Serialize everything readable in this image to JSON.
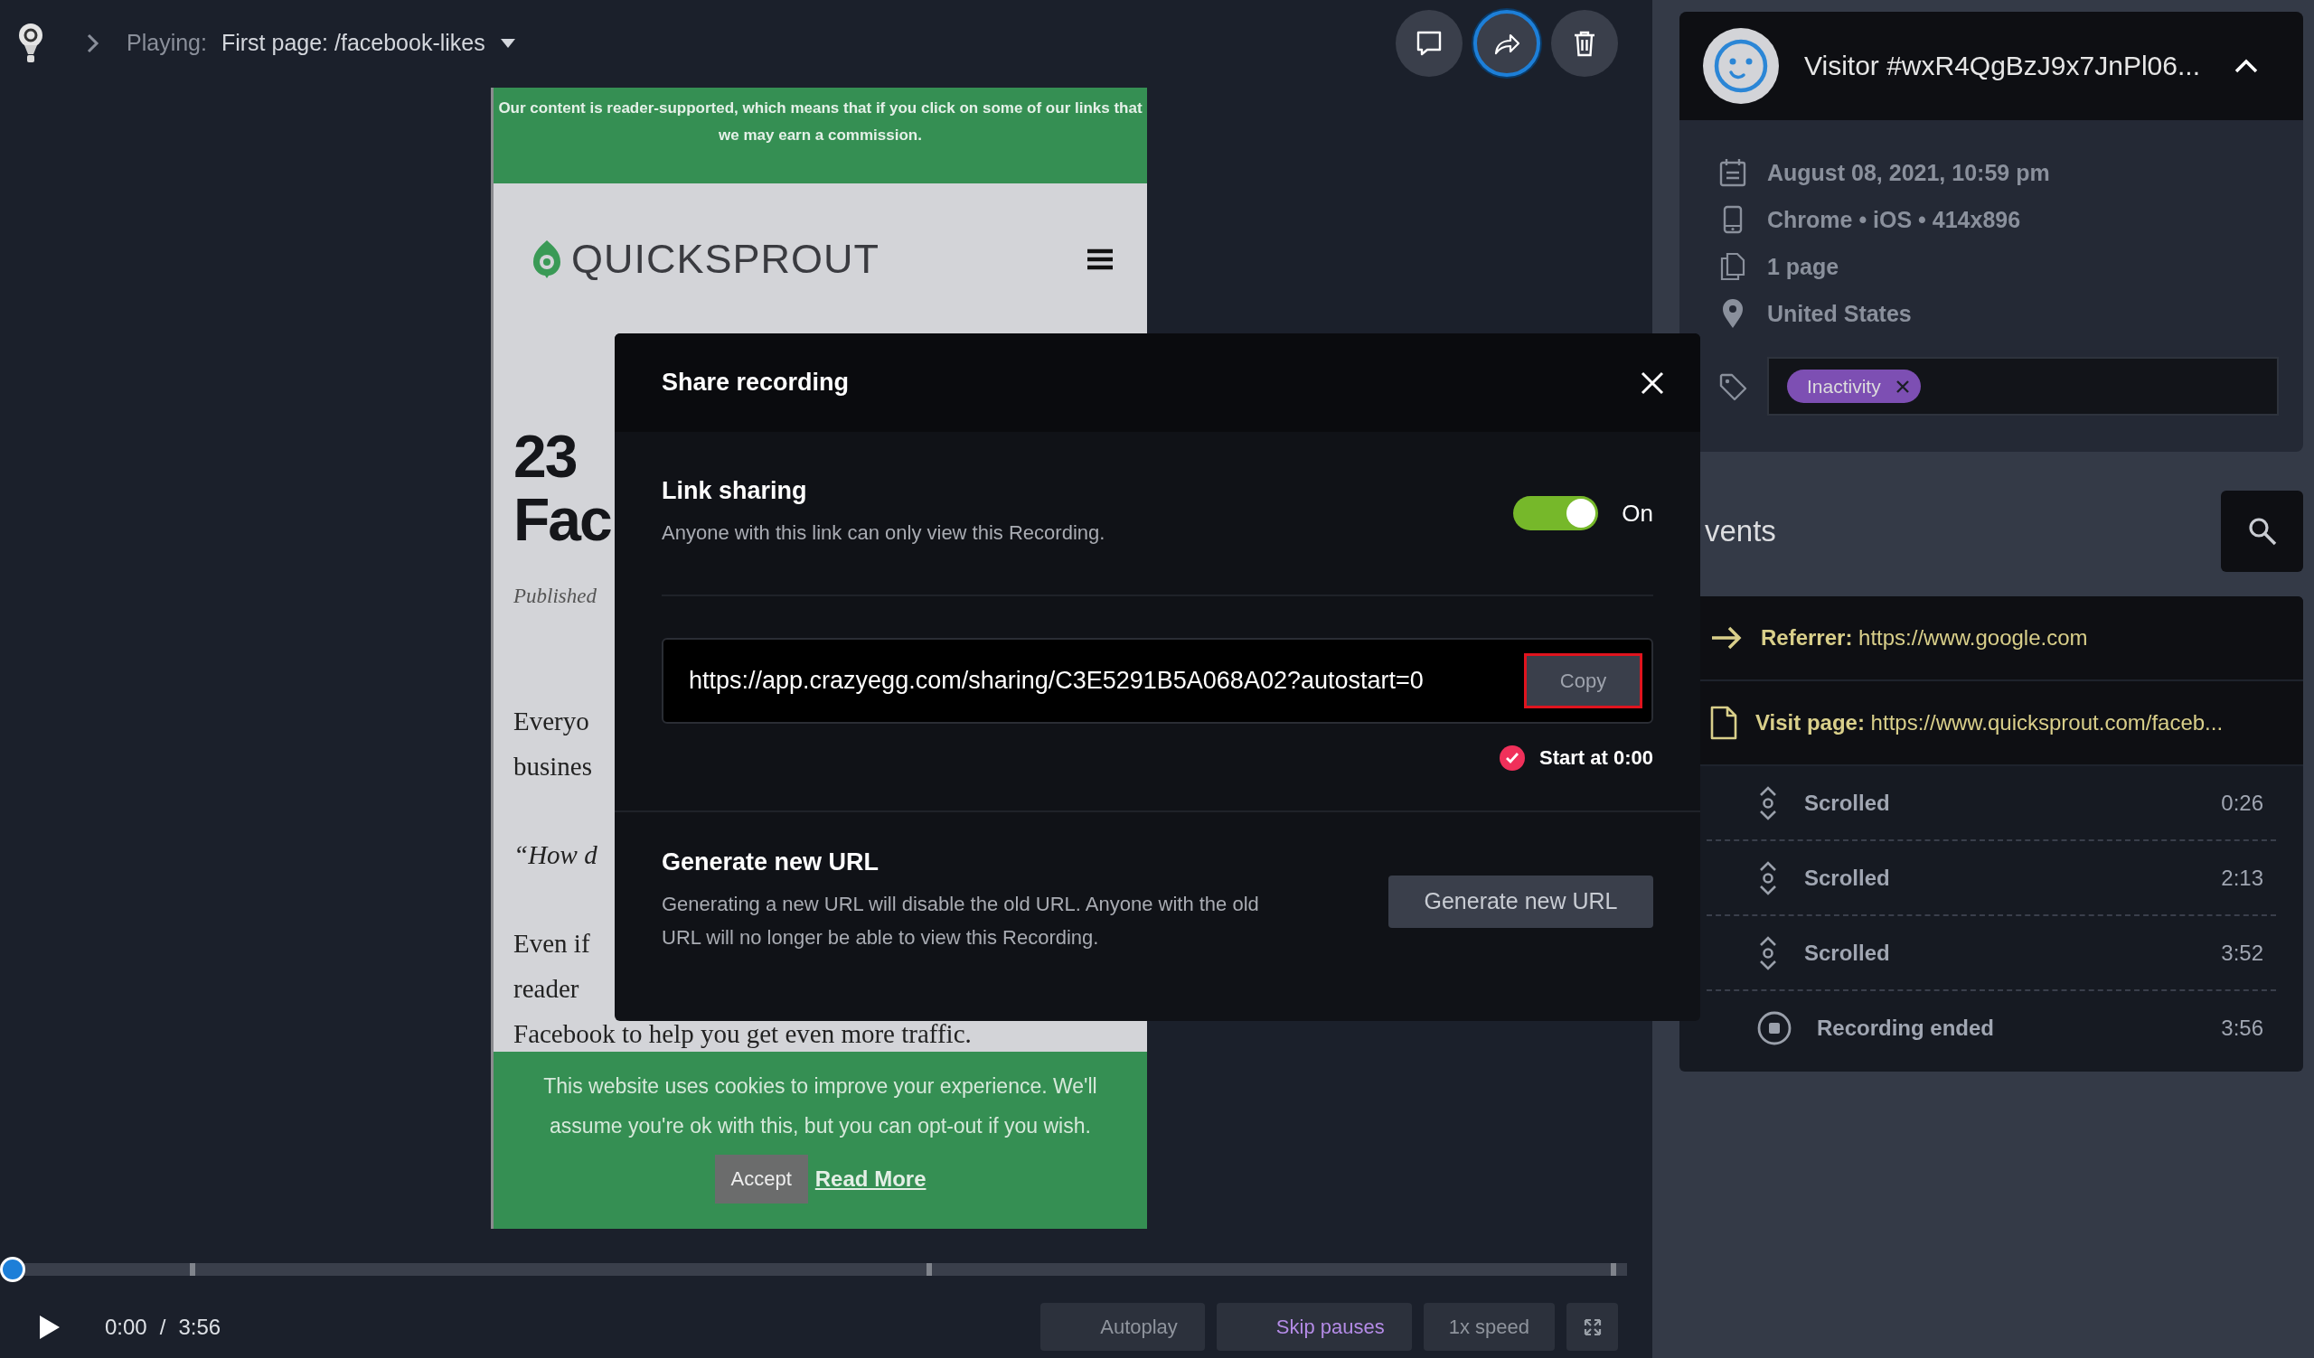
{
  "top_bar": {
    "label": "Playing:",
    "page": "First page: /facebook-likes",
    "buttons": [
      {
        "kind": "comment",
        "selected": false
      },
      {
        "kind": "share",
        "selected": true
      },
      {
        "kind": "delete",
        "selected": false
      }
    ]
  },
  "preview": {
    "banner": "Our content is reader-supported, which means that if you click on some of our links that we may earn a commission.",
    "logo": "QUICKSPROUT",
    "title_lines": [
      "23",
      "Fac"
    ],
    "published": "Published",
    "paragraphs": [
      {
        "kind": "text",
        "lines": [
          "Everyo",
          "busines"
        ]
      },
      {
        "kind": "quote",
        "lines": [
          "“How d"
        ]
      },
      {
        "kind": "text",
        "lines": [
          "Even if",
          "reader",
          "Facebook to help you get even more traffic."
        ]
      }
    ],
    "cookie": {
      "text": "This website uses cookies to improve your experience. We'll assume you're ok with this, but you can opt-out if you wish.",
      "accept": "Accept",
      "read_more": "Read More"
    }
  },
  "modal": {
    "title": "Share recording",
    "link_sharing": {
      "title": "Link sharing",
      "description": "Anyone with this link can only view this Recording.",
      "on": true,
      "state_label": "On"
    },
    "url": "https://app.crazyegg.com/sharing/C3E5291B5A068A02?autostart=0",
    "copy_label": "Copy",
    "start_at": {
      "checked": true,
      "label": "Start at 0:00"
    },
    "generate": {
      "title": "Generate new URL",
      "description": "Generating a new URL will disable the old URL. Anyone with the old URL will no longer be able to view this Recording.",
      "button": "Generate new URL"
    }
  },
  "player": {
    "level": 0,
    "time": "0:00",
    "separator": "/",
    "duration": "3:56",
    "toggles": [
      {
        "label": "Autoplay",
        "on": false
      },
      {
        "label": "Skip pauses",
        "on": true
      }
    ],
    "speed": "1x speed"
  },
  "visitor": {
    "name": "Visitor #wxR4QgBzJ9x7JnPl06...",
    "expanded": true,
    "details": [
      {
        "kind": "date",
        "text": "August 08, 2021, 10:59 pm"
      },
      {
        "kind": "device",
        "text": "Chrome • iOS • 414x896"
      },
      {
        "kind": "pages",
        "text": "1 page"
      },
      {
        "kind": "location",
        "text": "United States"
      }
    ],
    "tags": [
      {
        "label": "Inactivity",
        "color": "#7d4fb3"
      }
    ]
  },
  "events": {
    "title": "vents",
    "items": [
      {
        "kind": "referrer",
        "label": "Referrer:",
        "value": "https://www.google.com"
      },
      {
        "kind": "visit",
        "label": "Visit page:",
        "value": "https://www.quicksprout.com/faceb..."
      },
      {
        "kind": "scroll",
        "label": "Scrolled",
        "time": "0:26"
      },
      {
        "kind": "scroll",
        "label": "Scrolled",
        "time": "2:13"
      },
      {
        "kind": "scroll",
        "label": "Scrolled",
        "time": "3:52"
      },
      {
        "kind": "end",
        "label": "Recording ended",
        "time": "3:56"
      }
    ]
  }
}
